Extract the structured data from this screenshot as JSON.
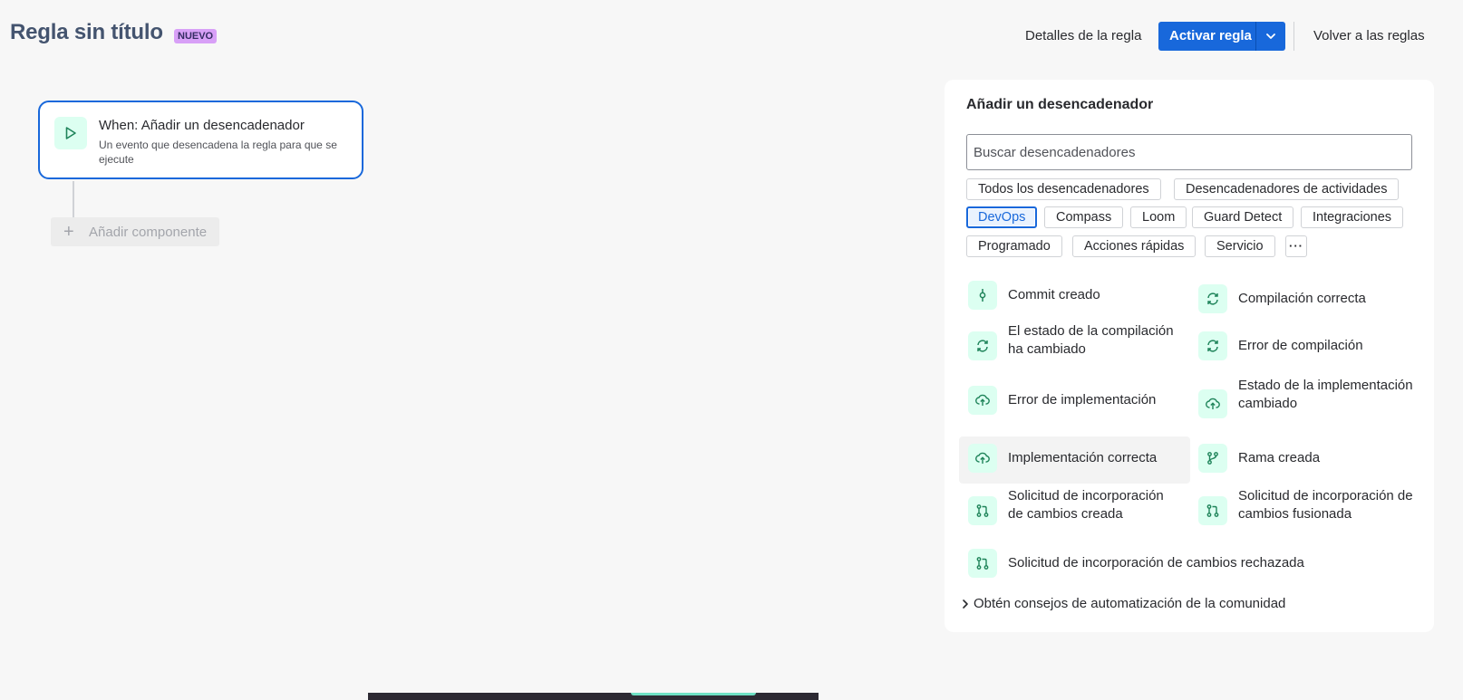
{
  "header": {
    "title": "Regla sin título",
    "badge": "NUEVO",
    "details_link": "Detalles de la regla",
    "activate_button": "Activar regla",
    "back_link": "Volver a las reglas"
  },
  "canvas": {
    "trigger_title": "When: Añadir un desencadenador",
    "trigger_description": "Un evento que desencadena la regla para que se ejecute",
    "add_component": "Añadir componente"
  },
  "panel": {
    "title": "Añadir un desencadenador",
    "search_placeholder": "Buscar desencadenadores",
    "chips": [
      "Todos los desencadenadores",
      "Desencadenadores de actividades",
      "DevOps",
      "Compass",
      "Loom",
      "Guard Detect",
      "Integraciones",
      "Programado",
      "Acciones rápidas",
      "Servicio"
    ],
    "selected_chip": "DevOps",
    "items": [
      {
        "label": "Commit creado",
        "icon": "commit-icon"
      },
      {
        "label": "Compilación correcta",
        "icon": "build-icon"
      },
      {
        "label": "El estado de la compilación ha cambiado",
        "icon": "build-icon"
      },
      {
        "label": "Error de compilación",
        "icon": "build-icon"
      },
      {
        "label": "Error de implementación",
        "icon": "deploy-icon"
      },
      {
        "label": "Estado de la implementación cambiado",
        "icon": "deploy-icon"
      },
      {
        "label": "Implementación correcta",
        "icon": "deploy-icon"
      },
      {
        "label": "Rama creada",
        "icon": "branch-icon"
      },
      {
        "label": "Solicitud de incorporación de cambios creada",
        "icon": "pull-request-icon"
      },
      {
        "label": "Solicitud de incorporación de cambios fusionada",
        "icon": "pull-request-icon"
      },
      {
        "label": "Solicitud de incorporación de cambios rechazada",
        "icon": "pull-request-icon"
      }
    ],
    "community_link": "Obtén consejos de automatización de la comunidad"
  },
  "colors": {
    "brand": "#1868db",
    "icon_bg": "#dcfff1",
    "icon_fg": "#1f845a",
    "badge_bg": "#d8a0f7"
  }
}
